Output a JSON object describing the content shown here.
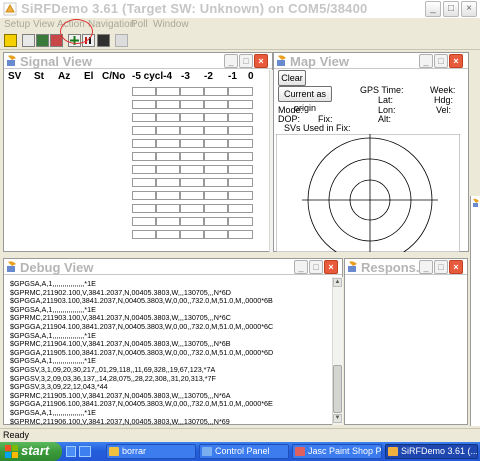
{
  "app": {
    "title": "SiRFDemo 3.61 (Target SW: Unknown) on COM5/38400"
  },
  "menu": [
    "Setup",
    "View",
    "Action",
    "Navigation",
    "Poll",
    "Window"
  ],
  "window_controls": {
    "minimize": "_",
    "maximize": "□",
    "close": "×"
  },
  "signal_view": {
    "title": "Signal View",
    "columns": [
      "SV",
      "St",
      "Az",
      "El",
      "C/No",
      "-5 cycl-4",
      "-3",
      "-2",
      "-1",
      "0"
    ],
    "row_count": 12
  },
  "map_view": {
    "title": "Map View",
    "clear_label": "Clear",
    "origin_label": "Current as origin",
    "fields": {
      "gps_time": "GPS Time:",
      "week": "Week:",
      "lat": "Lat:",
      "hdg": "Hdg:",
      "mode": "Mode:",
      "lon": "Lon:",
      "vel": "Vel:",
      "dop": "DOP:",
      "fix1": "Fix:",
      "alt": "Alt:",
      "svs": "SVs Used in Fix:"
    }
  },
  "debug_view": {
    "title": "Debug View",
    "lines": [
      "$GPGSA,A,1,,,,,,,,,,,,,,,,*1E",
      "$GPRMC,211902.100,V,3841.2037,N,00405.3803,W,,,130705,,,N*6D",
      "$GPGGA,211903.100,3841.2037,N,00405.3803,W,0,00,,732.0,M,51.0,M,,0000*6B",
      "$GPGSA,A,1,,,,,,,,,,,,,,,,*1E",
      "$GPRMC,211903.100,V,3841.2037,N,00405.3803,W,,,130705,,,N*6C",
      "$GPGGA,211904.100,3841.2037,N,00405.3803,W,0,00,,732.0,M,51.0,M,,0000*6C",
      "$GPGSA,A,1,,,,,,,,,,,,,,,,*1E",
      "$GPRMC,211904.100,V,3841.2037,N,00405.3803,W,,,130705,,,N*6B",
      "$GPGGA,211905.100,3841.2037,N,00405.3803,W,0,00,,732.0,M,51.0,M,,0000*6D",
      "$GPGSA,A,1,,,,,,,,,,,,,,,,*1E",
      "$GPGSV,3,1,09,20,30,217,,01,29,118,,11,69,328,,19,67,123,*7A",
      "$GPGSV,3,2,09,03,36,137,,14,28,075,,28,22,308,,31,20,313,*7F",
      "$GPGSV,3,3,09,22,12,043,*44",
      "$GPRMC,211905.100,V,3841.2037,N,00405.3803,W,,,130705,,,N*6A",
      "$GPGGA,211906.100,3841.2037,N,00405.3803,W,0,00,,732.0,M,51.0,M,,0000*6E",
      "$GPGSA,A,1,,,,,,,,,,,,,,,,*1E",
      "$GPRMC,211906.100,V,3841.2037,N,00405.3803,W,,,130705,,,N*69"
    ]
  },
  "response_view": {
    "title": "Respons..."
  },
  "status": {
    "text": "Ready"
  },
  "taskbar": {
    "start_label": "start",
    "tasks": [
      "borrar",
      "Control Panel",
      "Jasc Paint Shop Pro",
      "SiRFDemo 3.61 (..."
    ]
  }
}
